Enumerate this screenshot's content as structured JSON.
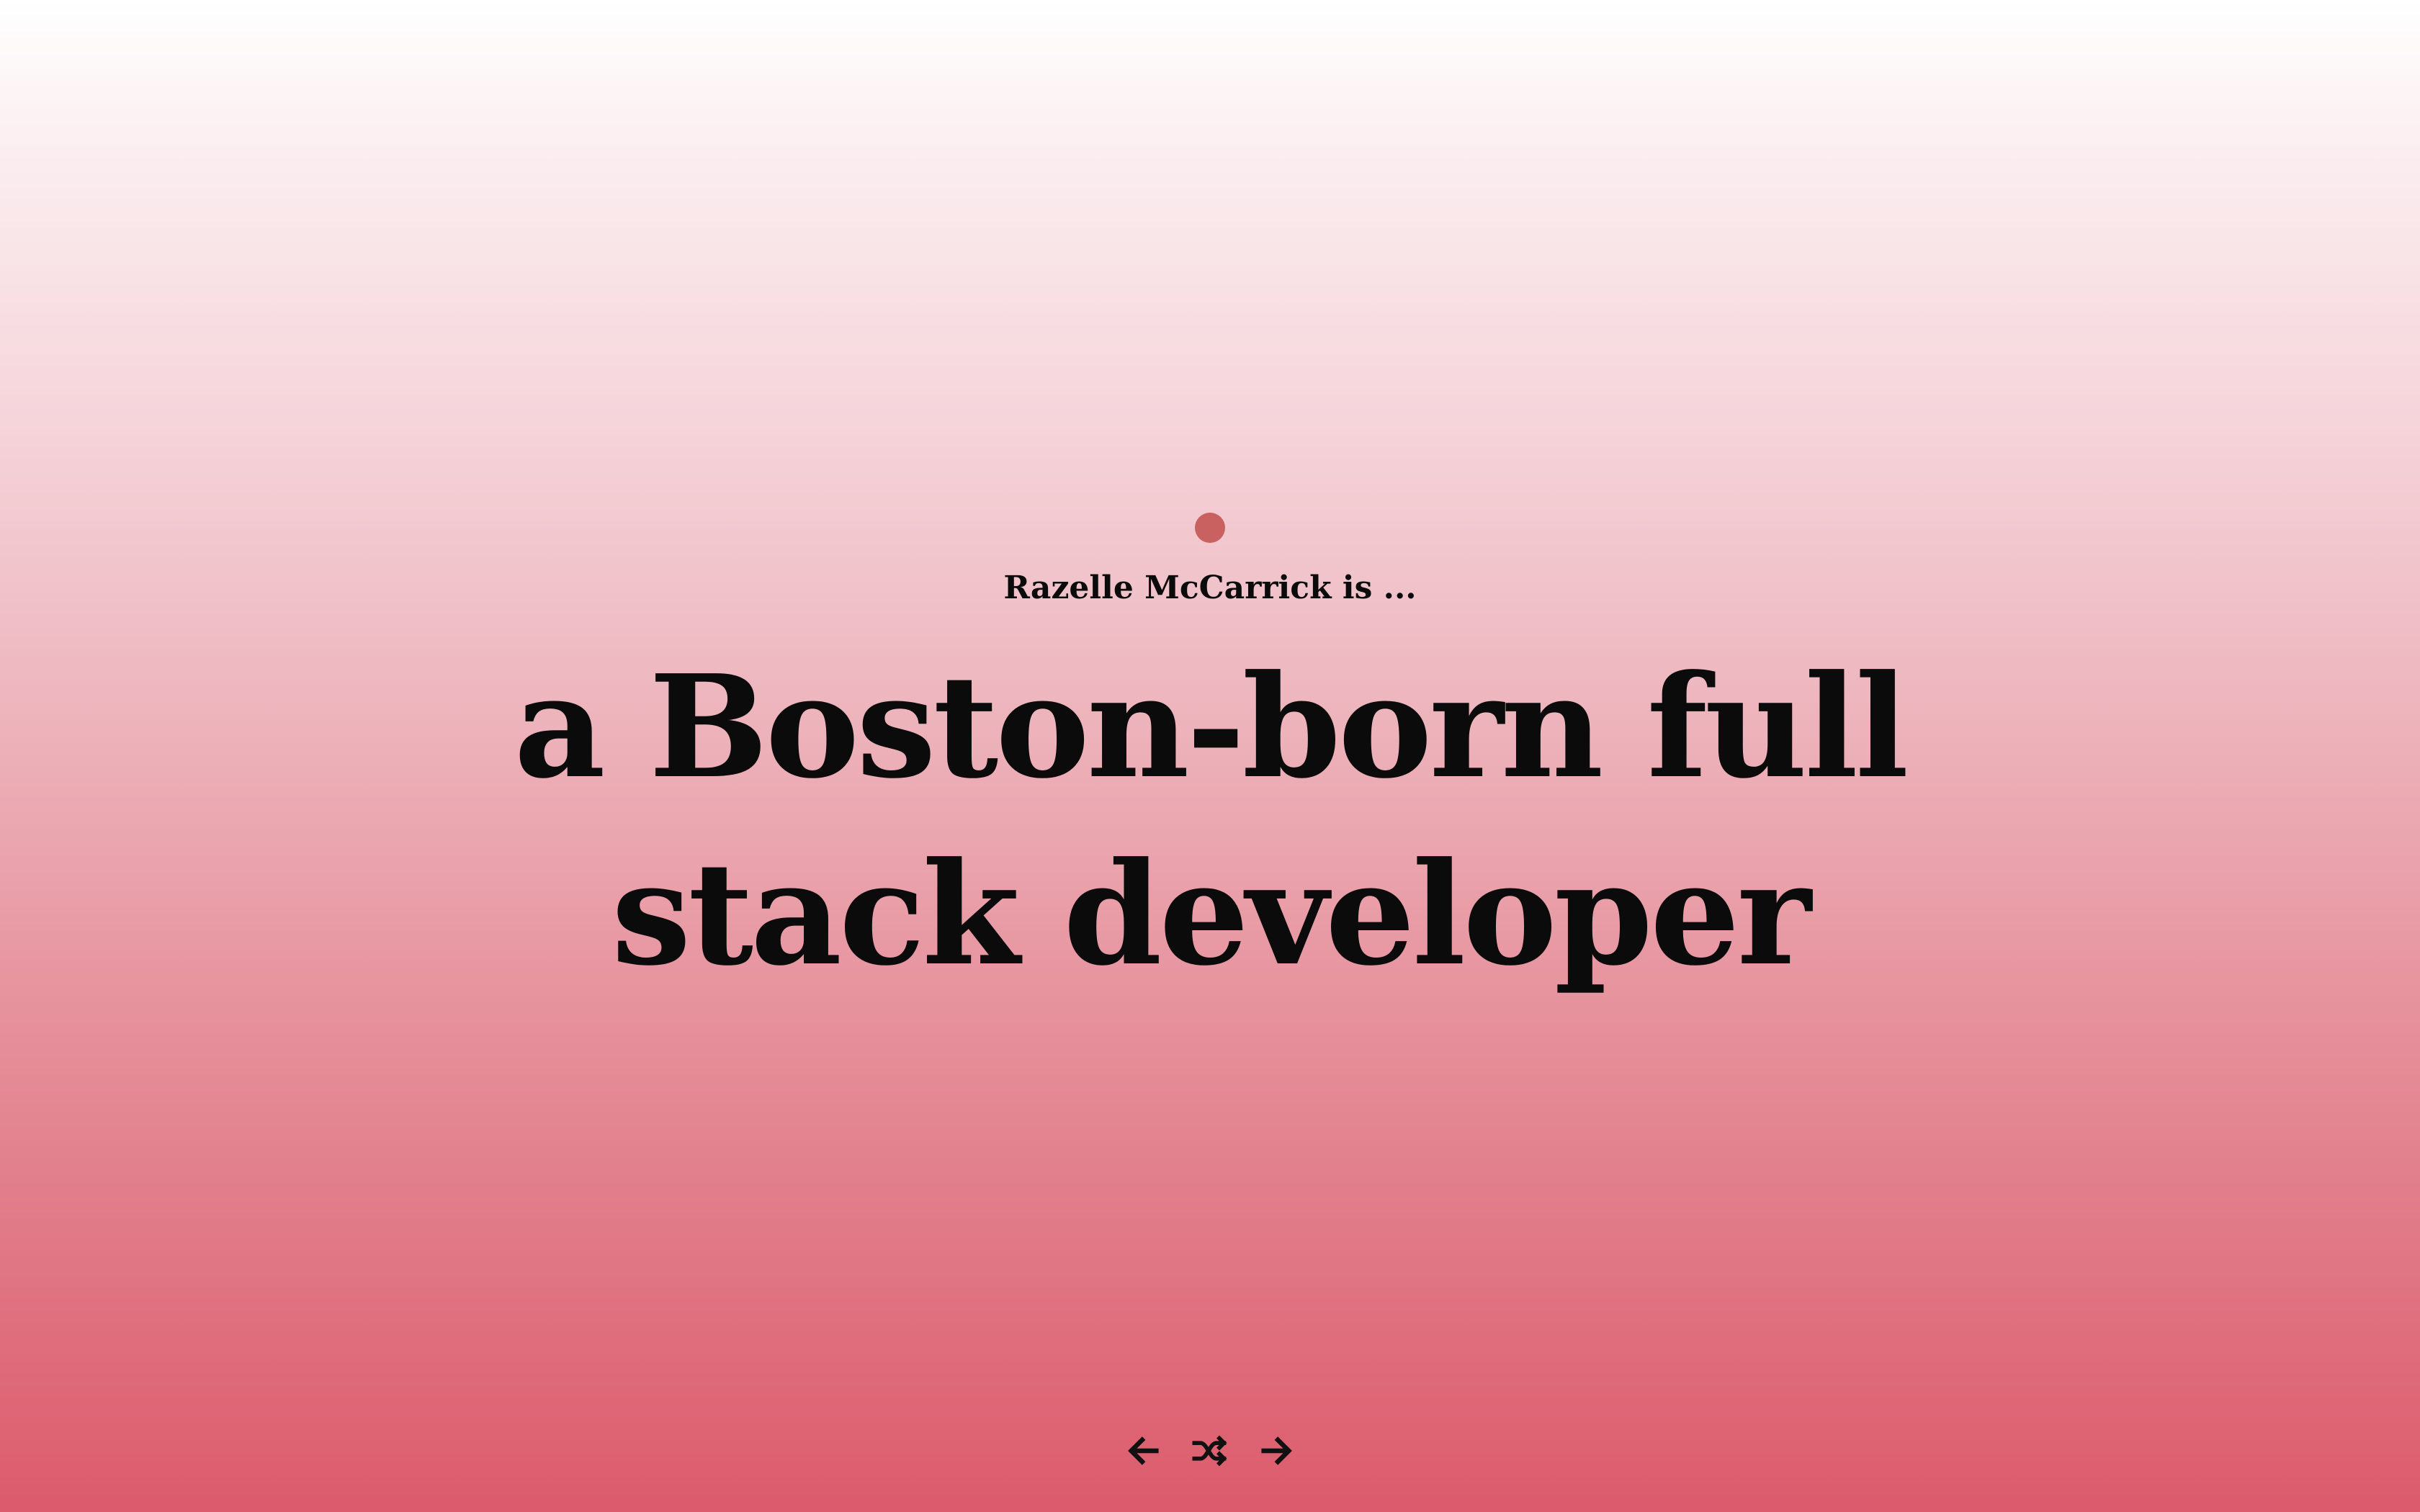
{
  "hero": {
    "eyebrow": "Razelle McCarrick is ...",
    "headline": "a Boston-born full stack developer",
    "accent_dot_color": "#c96160"
  },
  "controls": {
    "previous_icon": "arrow-left-icon",
    "shuffle_icon": "shuffle-icon",
    "next_icon": "arrow-right-icon"
  },
  "colors": {
    "gradient_top": "#ffffff",
    "gradient_bottom": "#dc5b6c",
    "text": "#0b0b0b"
  }
}
